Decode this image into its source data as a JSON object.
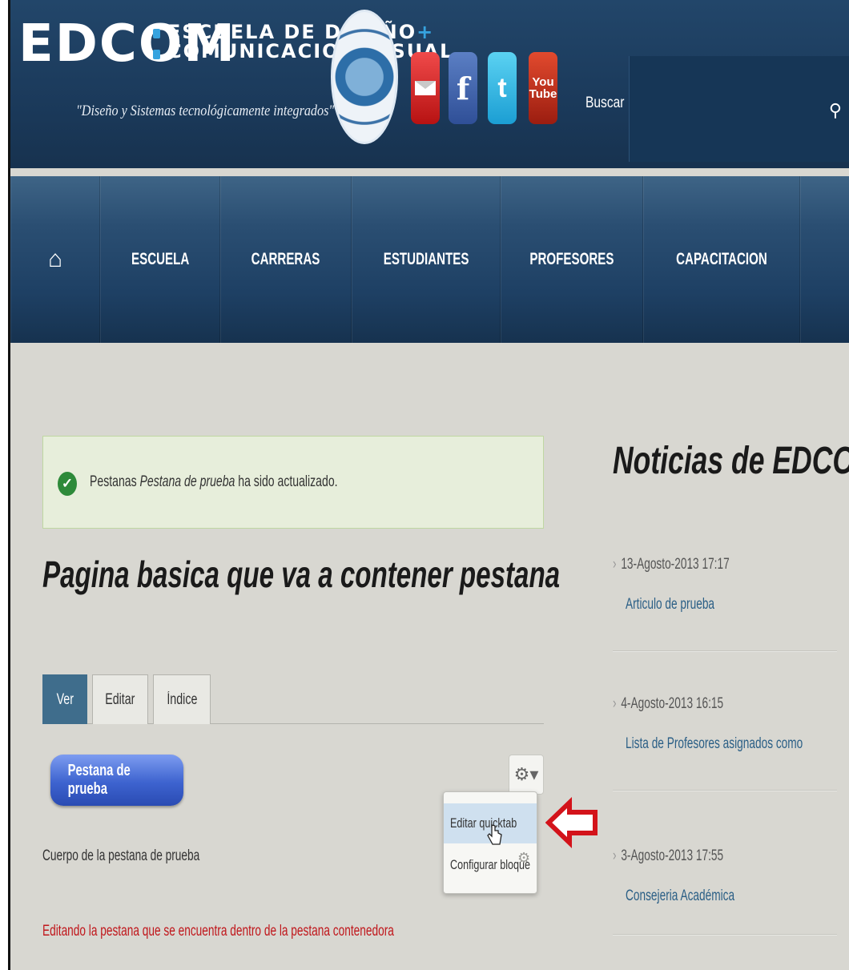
{
  "header": {
    "logo_text": "EDCOM",
    "logo_line1": "ESCUELA DE DISEÑO",
    "logo_plus": "+",
    "logo_line2": "COMUNICACION VISUAL",
    "tagline": "\"Diseño y Sistemas tecnológicamente integrados\"",
    "social": {
      "facebook_glyph": "f",
      "twitter_glyph": "t",
      "youtube_line1": "You",
      "youtube_line2": "Tube"
    },
    "search_label": "Buscar",
    "search_value": ""
  },
  "nav": {
    "items": [
      {
        "label": "ESCUELA"
      },
      {
        "label": "CARRERAS"
      },
      {
        "label": "ESTUDIANTES"
      },
      {
        "label": "PROFESORES"
      },
      {
        "label": "CAPACITACION"
      }
    ]
  },
  "message": {
    "prefix": "Pestanas ",
    "name": "Pestana de prueba",
    "suffix": " ha sido actualizado."
  },
  "page_title": "Pagina basica que va a contener pestana",
  "tabs": [
    {
      "label": "Ver",
      "active": true
    },
    {
      "label": "Editar",
      "active": false
    },
    {
      "label": "Índice",
      "active": false
    }
  ],
  "quicktab": {
    "button_label": "Pestana de prueba",
    "context_menu": [
      {
        "label": "Editar quicktab",
        "highlighted": true
      },
      {
        "label": "Configurar bloque",
        "highlighted": false
      }
    ]
  },
  "body_text": "Cuerpo de la pestana de prueba",
  "red_text": "Editando la pestana que se encuentra dentro de la pestana contenedora",
  "sidebar": {
    "title": "Noticias de EDCOM",
    "news": [
      {
        "date": "13-Agosto-2013 17:17",
        "title": "Articulo de prueba"
      },
      {
        "date": "4-Agosto-2013 16:15",
        "title": "Lista de Profesores asignados como"
      },
      {
        "date": "3-Agosto-2013 17:55",
        "title": "Consejeria Académica"
      }
    ]
  },
  "colors": {
    "header_bg": "#1b3a5b",
    "active_tab": "#3f6d8c",
    "link": "#2b5f86",
    "alert_red": "#c0171c",
    "success_green": "#2e8a3a"
  }
}
